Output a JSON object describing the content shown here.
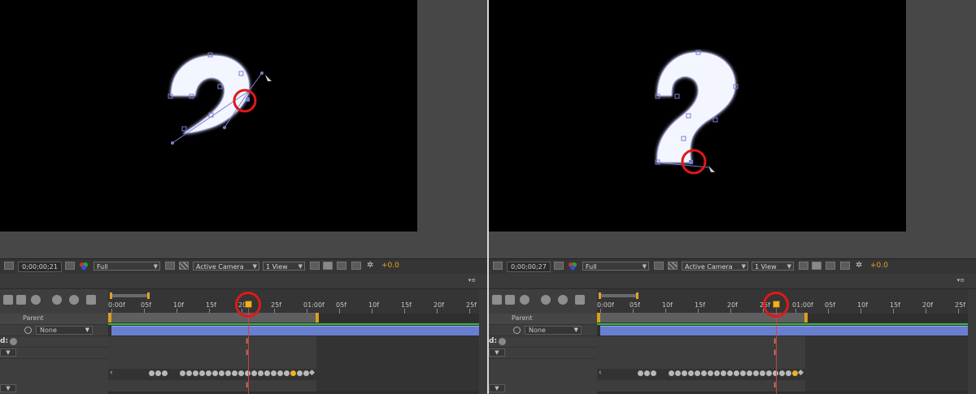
{
  "panels": [
    {
      "id": "left",
      "toolbar": {
        "timecode": "0;00;00;21",
        "resolution": "Full",
        "camera": "Active Camera",
        "views": "1 View",
        "exposure": "+0.0"
      },
      "timeline": {
        "parent_label": "Parent",
        "parent_value": "None",
        "d_label": "d:",
        "ruler_ticks": [
          "0:00f",
          "05f",
          "10f",
          "15f",
          "20f",
          "25f",
          "01:00f",
          "05f",
          "10f",
          "15f",
          "20f",
          "25f"
        ],
        "current_frame": 21,
        "keyframe_count": 24,
        "keyframe_current_index": 20
      }
    },
    {
      "id": "right",
      "toolbar": {
        "timecode": "0;00;00;27",
        "resolution": "Full",
        "camera": "Active Camera",
        "views": "1 View",
        "exposure": "+0.0"
      },
      "timeline": {
        "parent_label": "Parent",
        "parent_value": "None",
        "d_label": "d:",
        "ruler_ticks": [
          "0:00f",
          "05f",
          "10f",
          "15f",
          "20f",
          "25f",
          "01:00f",
          "05f",
          "10f",
          "15f",
          "20f",
          "25f"
        ],
        "current_frame": 27,
        "keyframe_count": 24,
        "keyframe_current_index": 22
      }
    }
  ],
  "colors": {
    "accent_orange": "#f0a020",
    "highlight_red": "#e01818",
    "layer_bar": "#6a7ed0",
    "work_area_green": "#37b74b",
    "path_handle": "#7a80d0"
  },
  "icons": [
    "region-of-interest-icon",
    "camera-snapshot-icon",
    "color-channels-icon",
    "transparency-grid-icon",
    "fast-preview-icon",
    "flowchart-icon",
    "draft-3d-icon",
    "motion-blur-icon",
    "graph-editor-icon",
    "stopwatch-icon",
    "play-icon",
    "spiral-icon"
  ]
}
